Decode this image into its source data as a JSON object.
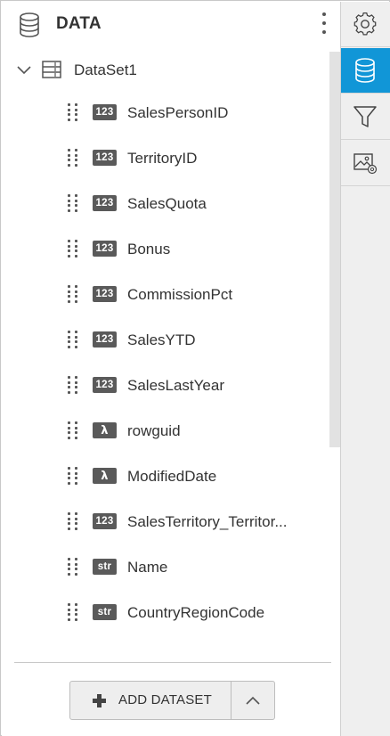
{
  "header": {
    "title": "DATA",
    "icon": "database-icon"
  },
  "dataset": {
    "label": "DataSet1",
    "expanded": true
  },
  "fields": [
    {
      "type": "123",
      "name": "SalesPersonID"
    },
    {
      "type": "123",
      "name": "TerritoryID"
    },
    {
      "type": "123",
      "name": "SalesQuota"
    },
    {
      "type": "123",
      "name": "Bonus"
    },
    {
      "type": "123",
      "name": "CommissionPct"
    },
    {
      "type": "123",
      "name": "SalesYTD"
    },
    {
      "type": "123",
      "name": "SalesLastYear"
    },
    {
      "type": "λ",
      "name": "rowguid"
    },
    {
      "type": "λ",
      "name": "ModifiedDate"
    },
    {
      "type": "123",
      "name": "SalesTerritory_Territor..."
    },
    {
      "type": "str",
      "name": "Name"
    },
    {
      "type": "str",
      "name": "CountryRegionCode"
    }
  ],
  "footer": {
    "add_label": "ADD DATASET"
  },
  "sidebar": {
    "tabs": [
      {
        "icon": "gear-icon",
        "active": false
      },
      {
        "icon": "database-icon",
        "active": true
      },
      {
        "icon": "filter-icon",
        "active": false
      },
      {
        "icon": "image-settings-icon",
        "active": false
      }
    ]
  },
  "colors": {
    "accent": "#1196d7",
    "badge": "#5a5a5a",
    "text": "#333333"
  }
}
